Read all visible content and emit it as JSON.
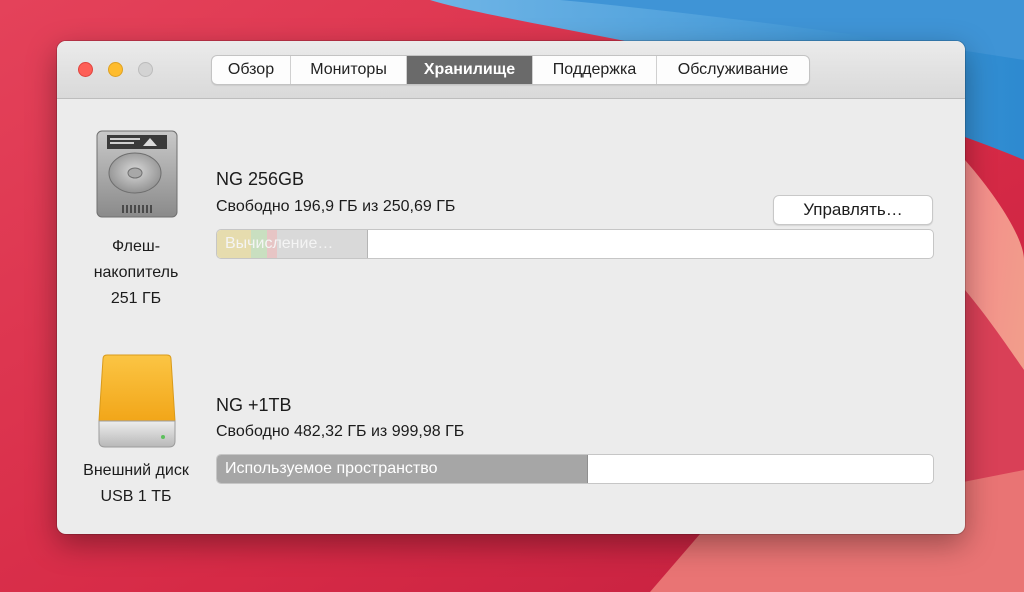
{
  "window": {
    "tabs": [
      {
        "label": "Обзор",
        "active": false
      },
      {
        "label": "Мониторы",
        "active": false
      },
      {
        "label": "Хранилище",
        "active": true
      },
      {
        "label": "Поддержка",
        "active": false
      },
      {
        "label": "Обслуживание",
        "active": false
      }
    ]
  },
  "disks": [
    {
      "name": "NG 256GB",
      "free_text": "Свободно 196,9 ГБ из 250,69 ГБ",
      "label_lines": [
        "Флеш-",
        "накопитель",
        "251 ГБ"
      ],
      "icon": "internal-drive-icon",
      "bar_text": "Вычисление…",
      "used_fraction": 0.21,
      "segments": [
        {
          "color": "#e6dcae",
          "fraction": 0.048
        },
        {
          "color": "#c9dfc0",
          "fraction": 0.022
        },
        {
          "color": "#e7c5c5",
          "fraction": 0.014
        },
        {
          "color": "#d9d9d9",
          "fraction": 0.126
        }
      ],
      "manage_label": "Управлять…"
    },
    {
      "name": "NG +1TB",
      "free_text": "Свободно 482,32 ГБ из 999,98 ГБ",
      "label_lines": [
        "Внешний диск",
        "USB 1 ТБ"
      ],
      "icon": "external-drive-icon",
      "bar_text": "Используемое пространство",
      "used_fraction": 0.517,
      "fill_color": "#a6a6a6"
    }
  ],
  "colors": {
    "active_tab": "#6a6a6a",
    "close": "#fe5f57",
    "minimize": "#febc2e",
    "external_drive": "#f9b52d"
  }
}
